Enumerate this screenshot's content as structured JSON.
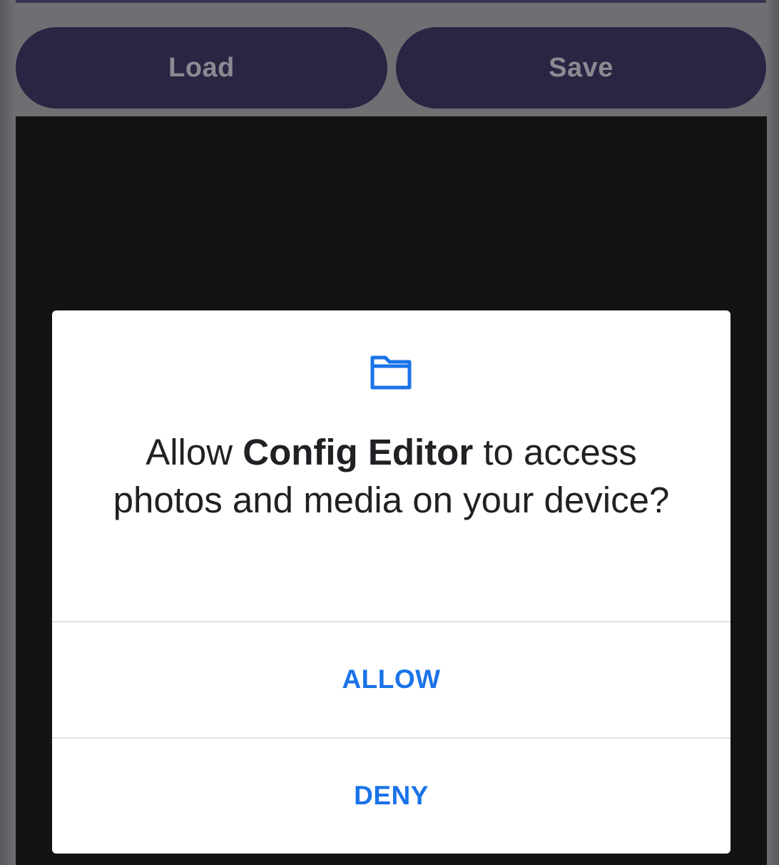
{
  "toolbar": {
    "load_label": "Load",
    "save_label": "Save",
    "button_color": "#2c2443"
  },
  "permission_dialog": {
    "icon": "folder-icon",
    "icon_color": "#1a73e8",
    "message_prefix": "Allow ",
    "app_name": "Config Editor",
    "message_suffix": " to access photos and media on your device?",
    "allow_label": "ALLOW",
    "deny_label": "DENY"
  },
  "colors": {
    "accent": "#1a73e8",
    "editor_background": "#131313",
    "scrim": "#6f6e72"
  }
}
